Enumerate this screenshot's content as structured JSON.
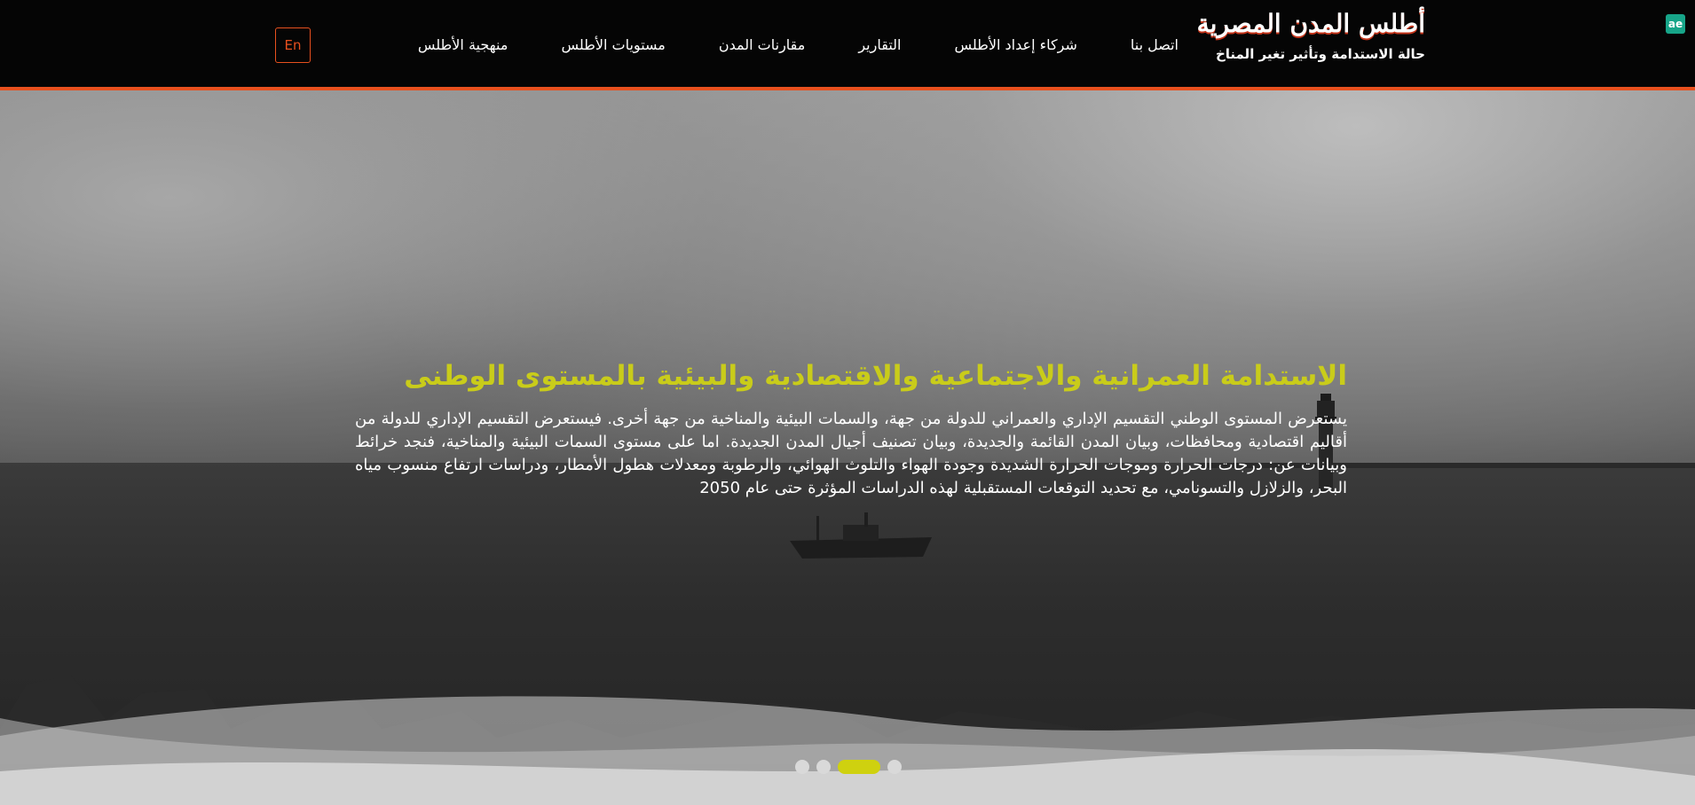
{
  "header": {
    "badge": "ae",
    "logo": {
      "title": "أطلس المدن المصرية",
      "subtitle": "حالة الاستدامة وتأثير تغير المناخ"
    },
    "nav": [
      {
        "label": "منهجية الأطلس"
      },
      {
        "label": "مستويات الأطلس"
      },
      {
        "label": "مقارنات المدن"
      },
      {
        "label": "التقارير"
      },
      {
        "label": "شركاء إعداد الأطلس"
      },
      {
        "label": "اتصل بنا"
      }
    ],
    "language_button": "En"
  },
  "hero": {
    "title": "الاستدامة العمرانية والاجتماعية والاقتصادية والبيئية بالمستوى الوطنى",
    "body": "يستعرض المستوى الوطني التقسيم الإداري والعمراني للدولة من جهة، والسمات البيئية والمناخية من جهة أخرى. فيستعرض التقسيم الإداري للدولة من أقاليم اقتصادية ومحافظات، وبيان المدن القائمة والجديدة، وبيان تصنيف أجيال المدن الجديدة. اما على مستوى السمات البيئية والمناخية، فنجد خرائط وبيانات عن: درجات الحرارة وموجات الحرارة الشديدة وجودة الهواء والتلوث الهوائي، والرطوبة ومعدلات هطول الأمطار، ودراسات ارتفاع منسوب مياه البحر، والزلازل والتسونامي، مع تحديد التوقعات المستقبلية لهذه الدراسات المؤثرة حتى عام 2050"
  },
  "carousel": {
    "slide_count": 4,
    "active_index": 2
  },
  "colors": {
    "accent_orange": "#e8501e",
    "title_yellow": "#c9cc1a",
    "active_dot": "#cfd10f",
    "badge_teal": "#17a589"
  }
}
